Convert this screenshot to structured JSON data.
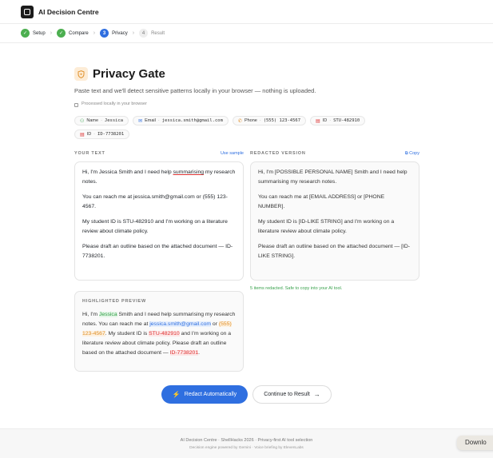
{
  "app": {
    "title": "AI Decision Centre"
  },
  "steps": [
    {
      "num": "✓",
      "label": "Setup",
      "state": "done"
    },
    {
      "num": "✓",
      "label": "Compare",
      "state": "done"
    },
    {
      "num": "3",
      "label": "Privacy",
      "state": "active"
    },
    {
      "num": "4",
      "label": "Result",
      "state": "future"
    }
  ],
  "page": {
    "title": "Privacy Gate",
    "subtitle": "Paste text and we'll detect sensitive patterns locally in your browser — nothing is uploaded.",
    "local_note": "Processed locally in your browser"
  },
  "chips": [
    {
      "icon": "user-icon",
      "glyph": "⚇",
      "type": "Name",
      "value": "Jessica",
      "color": "#2e9d44"
    },
    {
      "icon": "mail-icon",
      "glyph": "✉",
      "type": "Email",
      "value": "jessica.smith@gmail.com",
      "color": "#2f6fe0"
    },
    {
      "icon": "phone-icon",
      "glyph": "✆",
      "type": "Phone",
      "value": "(555) 123-4567",
      "color": "#e0902a"
    },
    {
      "icon": "id-card-icon",
      "glyph": "▤",
      "type": "ID",
      "value": "STU-482910",
      "color": "#d33"
    },
    {
      "icon": "id-card-icon",
      "glyph": "▤",
      "type": "ID",
      "value": "ID-7738201",
      "color": "#d33"
    }
  ],
  "your_text": {
    "label": "YOUR TEXT",
    "use_sample": "Use sample",
    "p1_pre": "Hi, I'm Jessica Smith and I need help ",
    "p1_u": "summarising",
    "p1_post": " my research notes.",
    "p2": "You can reach me at jessica.smith@gmail.com or (555) 123-4567.",
    "p3": "My student ID is STU-482910 and I'm working on a literature review about climate policy.",
    "p4": "Please draft an outline based on the attached document — ID-7738201."
  },
  "redacted": {
    "label": "REDACTED VERSION",
    "copy": "Copy",
    "p1": "Hi, I'm [POSSIBLE PERSONAL NAME] Smith and I need help summarising my research notes.",
    "p2": "You can reach me at [EMAIL ADDRESS] or [PHONE NUMBER].",
    "p3": "My student ID is [ID-LIKE STRING] and I'm working on a literature review about climate policy.",
    "p4": "Please draft an outline based on the attached document — [ID-LIKE STRING].",
    "status": "5 items redacted. Safe to copy into your AI tool."
  },
  "preview": {
    "label": "HIGHLIGHTED PREVIEW",
    "t1": "Hi, I'm ",
    "name": "Jessica",
    "t2": " Smith and I need help summarising my research notes. You can reach me at ",
    "email": "jessica.smith@gmail.com",
    "t3": " or ",
    "phone": "(555) 123-4567",
    "t4": ". My student ID is ",
    "id1": "STU-482910",
    "t5": " and I'm working on a literature review about climate policy. Please draft an outline based on the attached document — ",
    "id2": "ID-7738201",
    "t6": "."
  },
  "actions": {
    "redact": "Redact Automatically",
    "continue": "Continue to Result"
  },
  "footer": {
    "line1": "AI Decision Centre · ShellHacks 2026 · Privacy-first AI tool selection",
    "line2": "Decision engine powered by Gemini · Voice briefing by ElevenLabs"
  },
  "overlay": {
    "download": "Downlo"
  }
}
